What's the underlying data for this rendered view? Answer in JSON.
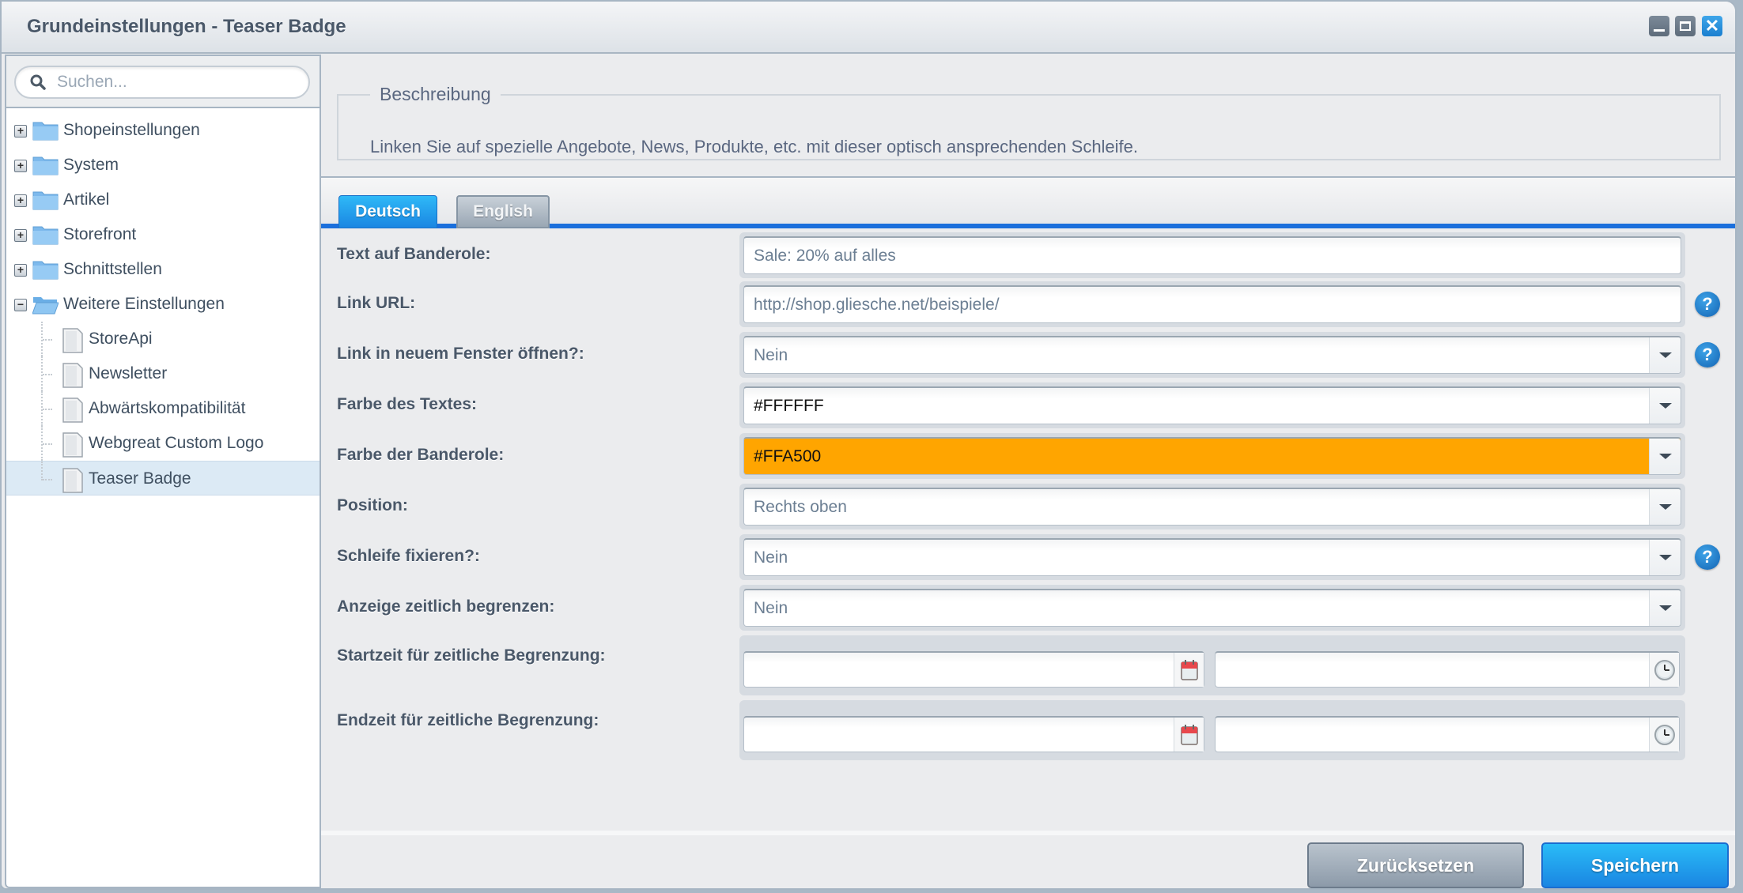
{
  "window": {
    "title": "Grundeinstellungen - Teaser Badge",
    "controls": [
      "minimize-icon",
      "maximize-icon",
      "close-icon"
    ]
  },
  "sidebar": {
    "search_placeholder": "Suchen...",
    "tree": [
      {
        "label": "Shopeinstellungen",
        "type": "folder",
        "expanded": false
      },
      {
        "label": "System",
        "type": "folder",
        "expanded": false
      },
      {
        "label": "Artikel",
        "type": "folder",
        "expanded": false
      },
      {
        "label": "Storefront",
        "type": "folder",
        "expanded": false
      },
      {
        "label": "Schnittstellen",
        "type": "folder",
        "expanded": false
      },
      {
        "label": "Weitere Einstellungen",
        "type": "folder",
        "expanded": true,
        "children": [
          {
            "label": "StoreApi",
            "type": "leaf"
          },
          {
            "label": "Newsletter",
            "type": "leaf"
          },
          {
            "label": "Abwärtskompatibilität",
            "type": "leaf"
          },
          {
            "label": "Webgreat Custom Logo",
            "type": "leaf"
          },
          {
            "label": "Teaser Badge",
            "type": "leaf",
            "selected": true
          }
        ]
      }
    ]
  },
  "description": {
    "legend": "Beschreibung",
    "text": "Linken Sie auf spezielle Angebote, News, Produkte, etc. mit dieser optisch ansprechenden Schleife."
  },
  "tabs": [
    {
      "label": "Deutsch",
      "active": true
    },
    {
      "label": "English",
      "active": false
    }
  ],
  "form": {
    "fields": [
      {
        "label": "Text auf Banderole:",
        "type": "text",
        "value": "Sale: 20% auf alles",
        "help": false
      },
      {
        "label": "Link URL:",
        "type": "text",
        "value": "http://shop.gliesche.net/beispiele/",
        "help": true
      },
      {
        "label": "Link in neuem Fenster öffnen?:",
        "type": "select",
        "value": "Nein",
        "help": true
      },
      {
        "label": "Farbe des Textes:",
        "type": "color",
        "value": "#FFFFFF",
        "swatch": "#FFFFFF",
        "help": false
      },
      {
        "label": "Farbe der Banderole:",
        "type": "color",
        "value": "#FFA500",
        "swatch": "#FFA500",
        "help": false
      },
      {
        "label": "Position:",
        "type": "select",
        "value": "Rechts oben",
        "help": false
      },
      {
        "label": "Schleife fixieren?:",
        "type": "select",
        "value": "Nein",
        "help": true
      },
      {
        "label": "Anzeige zeitlich begrenzen:",
        "type": "select",
        "value": "Nein",
        "help": false
      },
      {
        "label": "Startzeit für zeitliche Begrenzung:",
        "type": "datetime",
        "date": "",
        "time": ""
      },
      {
        "label": "Endzeit für zeitliche Begrenzung:",
        "type": "datetime",
        "date": "",
        "time": ""
      }
    ],
    "help_glyph": "?"
  },
  "toolbar": {
    "reset_label": "Zurücksetzen",
    "save_label": "Speichern"
  },
  "colors": {
    "accent": "#1A86E2",
    "tab_bar": "#1A6FDC",
    "banner_color": "#FFA500"
  }
}
